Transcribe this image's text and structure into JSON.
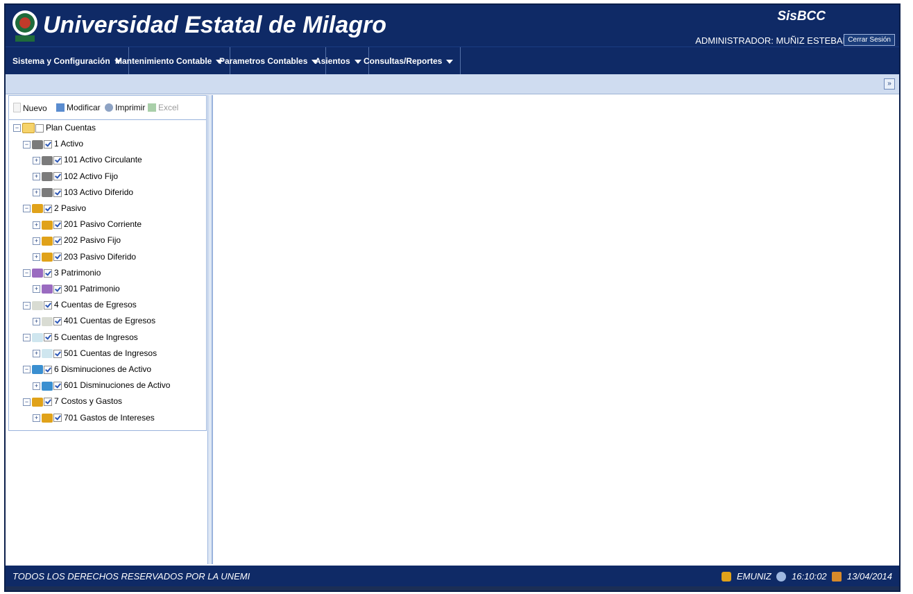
{
  "header": {
    "title": "Universidad Estatal de Milagro",
    "system_name": "SisBCC",
    "user_label": "ADMINISTRADOR: MUÑIZ ESTEBAN",
    "logout_label": "Cerrar Sesión"
  },
  "menu": [
    {
      "label": "Sistema y Configuración"
    },
    {
      "label": "Mantenimiento Contable"
    },
    {
      "label": "Parametros Contables"
    },
    {
      "label": "Asientos"
    },
    {
      "label": "Consultas/Reportes"
    }
  ],
  "toolbar": {
    "new_label": "Nuevo",
    "edit_label": "Modificar",
    "print_label": "Imprimir",
    "excel_label": "Excel"
  },
  "tree": {
    "root": "Plan Cuentas",
    "nodes": [
      {
        "label": "1 Activo",
        "color": "#7b7b7b"
      },
      {
        "label": "101 Activo Circulante",
        "color": "#7b7b7b"
      },
      {
        "label": "102 Activo Fijo",
        "color": "#7b7b7b"
      },
      {
        "label": "103 Activo Diferido",
        "color": "#7b7b7b"
      },
      {
        "label": "2 Pasivo",
        "color": "#e0a21a"
      },
      {
        "label": "201 Pasivo Corriente",
        "color": "#e0a21a"
      },
      {
        "label": "202 Pasivo Fijo",
        "color": "#e0a21a"
      },
      {
        "label": "203 Pasivo Diferido",
        "color": "#e0a21a"
      },
      {
        "label": "3 Patrimonio",
        "color": "#9a6bc0"
      },
      {
        "label": "301 Patrimonio",
        "color": "#9a6bc0"
      },
      {
        "label": "4 Cuentas de Egresos",
        "color": "#d9dcd3"
      },
      {
        "label": "401 Cuentas de Egresos",
        "color": "#d9dcd3"
      },
      {
        "label": "5 Cuentas de Ingresos",
        "color": "#cfe6ef"
      },
      {
        "label": "501 Cuentas de Ingresos",
        "color": "#cfe6ef"
      },
      {
        "label": "6 Disminuciones de Activo",
        "color": "#3a8fd0"
      },
      {
        "label": "601 Disminuciones de Activo",
        "color": "#3a8fd0"
      },
      {
        "label": "7 Costos y Gastos",
        "color": "#e0a21a"
      },
      {
        "label": "701 Gastos de Intereses",
        "color": "#e0a21a"
      }
    ]
  },
  "footer": {
    "rights": "TODOS LOS DERECHOS RESERVADOS POR LA UNEMI",
    "user": "EMUNIZ",
    "time": "16:10:02",
    "date": "13/04/2014"
  }
}
